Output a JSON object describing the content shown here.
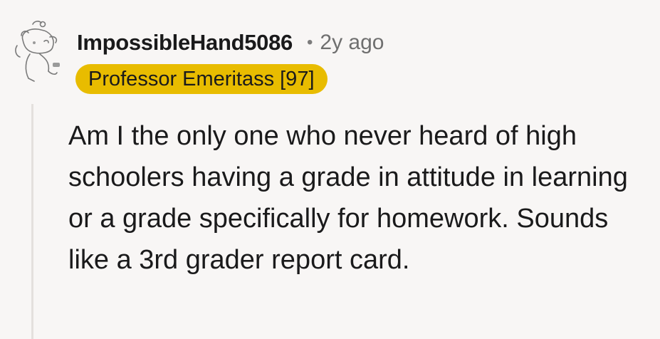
{
  "comment": {
    "username": "ImpossibleHand5086",
    "separator": "•",
    "timestamp": "2y ago",
    "flair": "Professor Emeritass [97]",
    "body": "Am I the only one who never heard of high schoolers having a grade in attitude in learning or a grade specifically for homework. Sounds like a 3rd grader report card.",
    "avatar_icon": "snoo-avatar-icon"
  },
  "colors": {
    "background": "#f8f6f5",
    "flair_background": "#e8bc00",
    "thread_line": "#e4e0dd",
    "text": "#1a1a1b",
    "muted_text": "#6f6f6f"
  }
}
